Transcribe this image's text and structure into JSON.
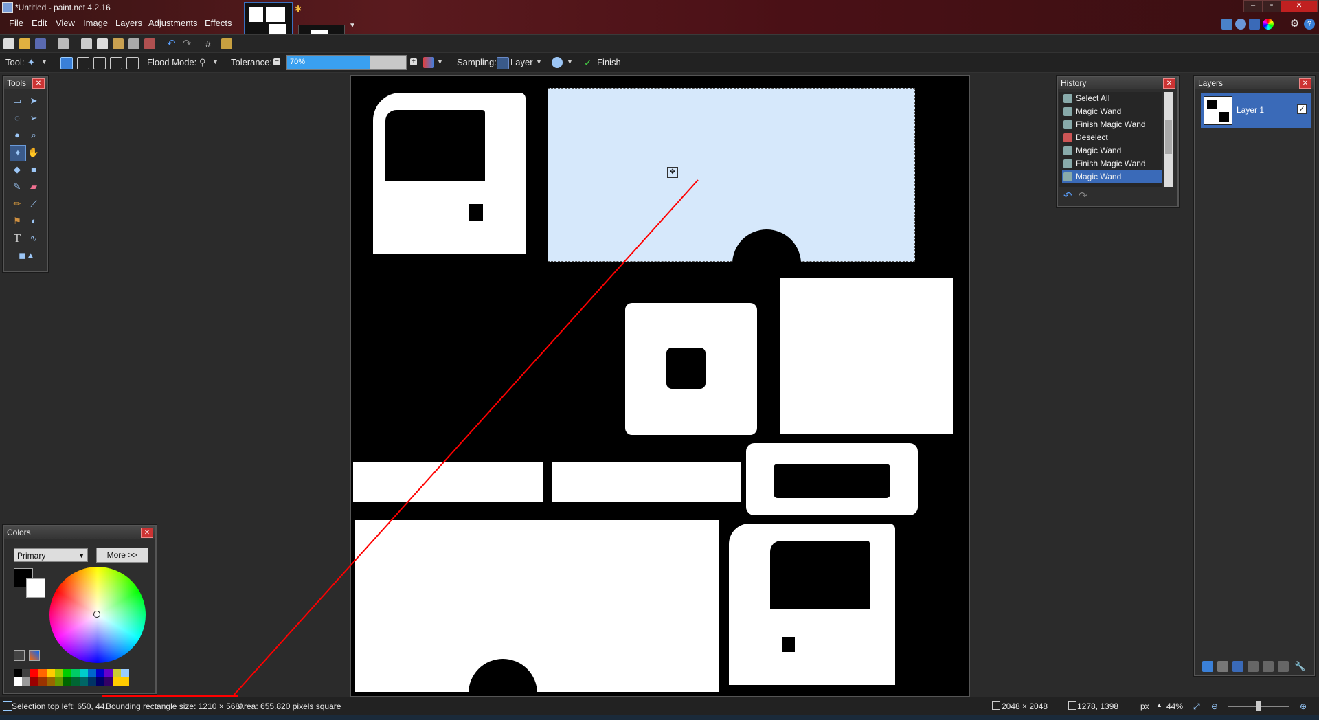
{
  "window": {
    "title": "*Untitled - paint.net 4.2.16"
  },
  "menu": [
    "File",
    "Edit",
    "View",
    "Image",
    "Layers",
    "Adjustments",
    "Effects"
  ],
  "toolbar": {
    "tool_label": "Tool:",
    "flood_mode_label": "Flood Mode:",
    "tolerance_label": "Tolerance:",
    "tolerance_value": "70%",
    "tolerance_fraction": 0.7,
    "sampling_label": "Sampling:",
    "sampling_value": "Layer",
    "finish_label": "Finish"
  },
  "tools_panel": {
    "title": "Tools"
  },
  "history_panel": {
    "title": "History",
    "items": [
      "Select All",
      "Magic Wand",
      "Finish Magic Wand",
      "Deselect",
      "Magic Wand",
      "Finish Magic Wand",
      "Magic Wand"
    ],
    "selected_index": 6
  },
  "layers_panel": {
    "title": "Layers",
    "layer_name": "Layer 1"
  },
  "colors_panel": {
    "title": "Colors",
    "mode": "Primary",
    "more_button": "More >>"
  },
  "status": {
    "selection_top_left": "Selection top left: 650, 44.",
    "bounding_size": "Bounding rectangle size: 1210 × 568.",
    "area": "Area: 655.820 pixels square",
    "image_size": "2048 × 2048",
    "cursor_pos": "1278, 1398",
    "unit": "px",
    "zoom": "44%"
  },
  "colors": {
    "accent": "#3aa0f0",
    "selection": "#d6e8fb",
    "annotation": "#ff0000"
  }
}
